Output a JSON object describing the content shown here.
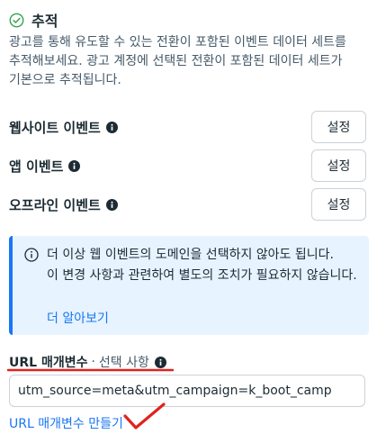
{
  "section": {
    "title": "추적",
    "description_lines": [
      "광고를 통해 유도할 수 있는 전환이 포함된 이벤트 데이터 세트를",
      "추적해보세요. 광고 계정에 선택된 전환이 포함된 데이터 세트가",
      "기본으로 추적됩니다."
    ]
  },
  "events": [
    {
      "label": "웹사이트 이벤트",
      "button": "설정"
    },
    {
      "label": "앱 이벤트",
      "button": "설정"
    },
    {
      "label": "오프라인 이벤트",
      "button": "설정"
    }
  ],
  "notice": {
    "lines": [
      "더 이상 웹 이벤트의 도메인을 선택하지 않아도 됩니다.",
      "이 변경 사항과 관련하여 별도의 조치가 필요하지 않습니다."
    ],
    "link": "더 알아보기"
  },
  "url_params": {
    "label": "URL 매개변수",
    "separator": "·",
    "optional": "선택 사항",
    "value": "utm_source=meta&utm_campaign=k_boot_camp",
    "builder_link": "URL 매개변수 만들기"
  },
  "colors": {
    "accent": "#1877f2",
    "notice_bg": "#e7f3ff",
    "annotation_red": "#e0231c",
    "success_green": "#31a24c"
  },
  "icons": {
    "header": "check-circle-icon",
    "info": "info-icon",
    "notice": "info-circle-outline-icon"
  }
}
